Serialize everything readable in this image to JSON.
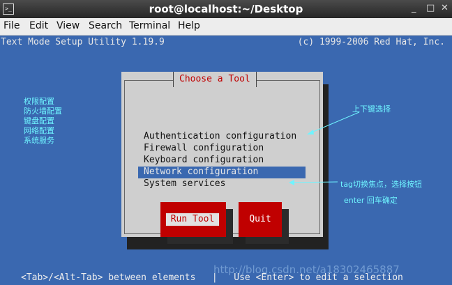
{
  "window": {
    "title": "root@localhost:~/Desktop",
    "minimize_glyph": "_",
    "maximize_glyph": "□",
    "close_glyph": "✕"
  },
  "menubar": {
    "items": [
      "File",
      "Edit",
      "View",
      "Search",
      "Terminal",
      "Help"
    ]
  },
  "terminal": {
    "header_left": "Text Mode Setup Utility 1.19.9",
    "header_right": "(c) 1999-2006 Red Hat, Inc.",
    "footer": "<Tab>/<Alt-Tab> between elements   |   Use <Enter> to edit a selection"
  },
  "dialog": {
    "title": "Choose a Tool",
    "options": [
      "Authentication configuration",
      "Firewall configuration",
      "Keyboard configuration",
      "Network configuration",
      "System services"
    ],
    "selected_index": 3,
    "run_button": "Run Tool",
    "quit_button": "Quit"
  },
  "annotations": {
    "left_list": [
      "权限配置",
      "防火墙配置",
      "键盘配置",
      "网络配置",
      "系统服务"
    ],
    "updown": "上下键选择",
    "tag": "tag切换焦点，选择按钮",
    "enter": "enter 回车确定"
  },
  "watermark": "http://blog.csdn.net/a18302465887",
  "colors": {
    "terminal_bg": "#3a68b0",
    "dialog_bg": "#cfcfcf",
    "accent_red": "#c00000",
    "annotation_cyan": "#6ff4ff"
  }
}
